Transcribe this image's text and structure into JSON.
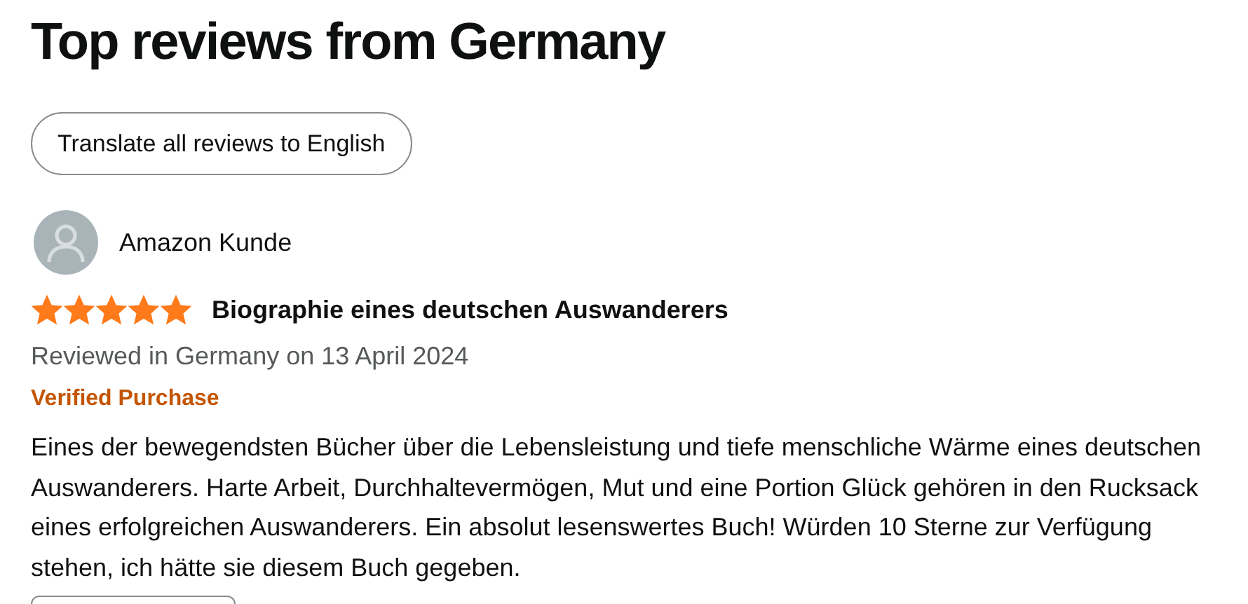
{
  "heading": "Top reviews from Germany",
  "translate_button": {
    "label": "Translate all reviews to English"
  },
  "reviews": [
    {
      "author": "Amazon Kunde",
      "stars": 5,
      "title": "Biographie eines deutschen Auswanderers",
      "date": "Reviewed in Germany on 13 April 2024",
      "verified": "Verified Purchase",
      "body": "Eines der bewegendsten Bücher über die Lebensleistung und tiefe menschliche Wärme eines deutschen Auswanderers. Harte Arbeit, Durchhaltevermögen, Mut und eine Portion Glück gehören in den Rucksack eines erfolgreichen Auswanderers. Ein absolut lesenswertes Buch! Würden 10 Sterne zur Verfügung stehen, ich hätte sie diesem Buch gegeben."
    }
  ]
}
